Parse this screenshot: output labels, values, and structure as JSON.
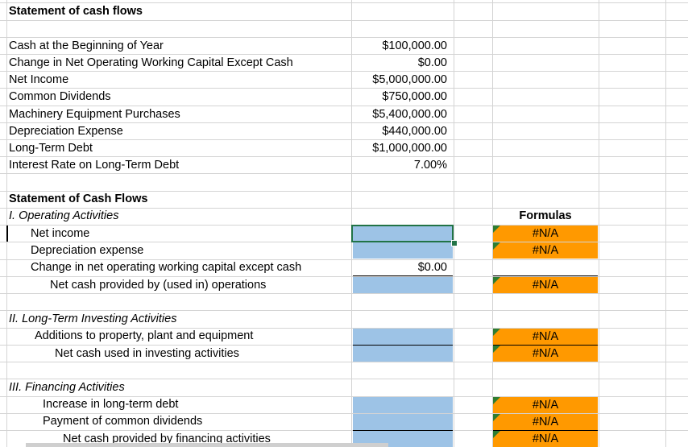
{
  "sheet": {
    "section_title": "Statement of cash flows",
    "inputs": [
      {
        "label": "Cash at the Beginning of Year",
        "value": "$100,000.00"
      },
      {
        "label": "Change in Net Operating Working Capital Except Cash",
        "value": "$0.00"
      },
      {
        "label": "Net Income",
        "value": "$5,000,000.00"
      },
      {
        "label": "Common Dividends",
        "value": "$750,000.00"
      },
      {
        "label": "Machinery Equipment Purchases",
        "value": "$5,400,000.00"
      },
      {
        "label": "Depreciation Expense",
        "value": "$440,000.00"
      },
      {
        "label": "Long-Term Debt",
        "value": "$1,000,000.00"
      },
      {
        "label": "Interest Rate on Long-Term Debt",
        "value": "7.00%"
      }
    ],
    "statement_title": "Statement of Cash Flows",
    "formulas_header": "Formulas",
    "operating": {
      "heading": "I. Operating Activities",
      "net_income": "Net income",
      "depreciation": "Depreciation expense",
      "nowc_change": "Change in net operating working capital except cash",
      "nowc_value": "$0.00",
      "net_cash": "Net cash provided by (used in) operations"
    },
    "investing": {
      "heading": "II. Long-Term Investing Activities",
      "additions": "Additions to property, plant and equipment",
      "net_cash": "Net cash used in investing activities"
    },
    "financing": {
      "heading": "III. Financing Activities",
      "increase_debt": "Increase in long-term debt",
      "payment_dividends": "Payment of common dividends",
      "net_cash": "Net cash provided by financing activities"
    },
    "na": "#N/A"
  }
}
